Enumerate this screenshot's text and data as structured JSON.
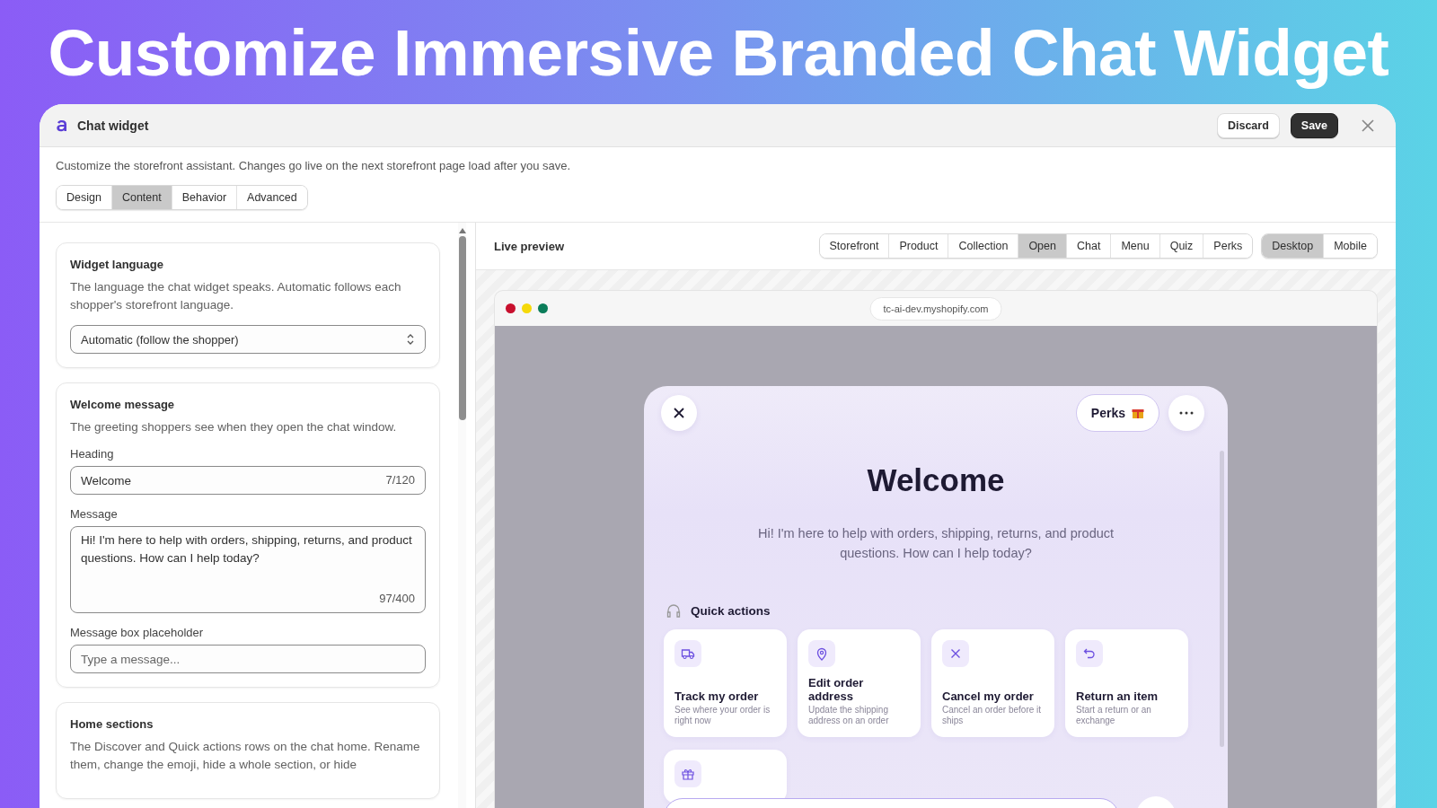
{
  "banner": {
    "headline": "Customize Immersive Branded Chat Widget"
  },
  "window": {
    "title": "Chat widget",
    "buttons": [
      {
        "label": "Discard",
        "kind": "secondary"
      },
      {
        "label": "Save",
        "kind": "primary"
      }
    ]
  },
  "description": "Customize the storefront assistant. Changes go live on the next storefront page load after you save.",
  "tabs": [
    {
      "label": "Design",
      "selected": false
    },
    {
      "label": "Content",
      "selected": true
    },
    {
      "label": "Behavior",
      "selected": false
    },
    {
      "label": "Advanced",
      "selected": false
    }
  ],
  "settings_cards": [
    {
      "title": "Widget language",
      "description": "The language the chat widget speaks. Automatic follows each shopper's storefront language.",
      "fields": [
        {
          "kind": "select",
          "value": "Automatic (follow the shopper)"
        }
      ]
    },
    {
      "title": "Welcome message",
      "description": "The greeting shoppers see when they open the chat window.",
      "fields": [
        {
          "kind": "text",
          "label": "Heading",
          "value": "Welcome",
          "counter": "7/120"
        },
        {
          "kind": "textarea",
          "label": "Message",
          "value": "Hi! I'm here to help with orders, shipping, returns, and product questions. How can I help today?",
          "counter": "97/400"
        },
        {
          "kind": "text",
          "label": "Message box placeholder",
          "placeholder": "Type a message..."
        }
      ]
    },
    {
      "title": "Home sections",
      "description": "The Discover and Quick actions rows on the chat home. Rename them, change the emoji, hide a whole section, or hide"
    }
  ],
  "preview": {
    "title": "Live preview",
    "pages": [
      {
        "label": "Storefront",
        "selected": false
      },
      {
        "label": "Product",
        "selected": false
      },
      {
        "label": "Collection",
        "selected": false
      },
      {
        "label": "Open",
        "selected": true
      },
      {
        "label": "Chat",
        "selected": false
      },
      {
        "label": "Menu",
        "selected": false
      },
      {
        "label": "Quiz",
        "selected": false
      },
      {
        "label": "Perks",
        "selected": false
      }
    ],
    "devices": [
      {
        "label": "Desktop",
        "selected": true
      },
      {
        "label": "Mobile",
        "selected": false
      }
    ],
    "browser": {
      "dots": [
        {
          "color": "#c8102e"
        },
        {
          "color": "#f5d90a"
        },
        {
          "color": "#0b7d5a"
        }
      ],
      "url": "tc-ai-dev.myshopify.com"
    },
    "widget": {
      "perks_label": "Perks",
      "heading": "Welcome",
      "message": "Hi! I'm here to help with orders, shipping, returns, and product questions. How can I help today?",
      "quick_actions_title": "Quick actions",
      "quick_actions": [
        {
          "kind": "truck",
          "title": "Track my order",
          "description": "See where your order is right now"
        },
        {
          "kind": "pin",
          "title": "Edit order address",
          "description": "Update the shipping address on an order"
        },
        {
          "kind": "cross",
          "title": "Cancel my order",
          "description": "Cancel an order before it ships"
        },
        {
          "kind": "undo",
          "title": "Return an item",
          "description": "Start a return or an exchange"
        },
        {
          "kind": "gift"
        }
      ]
    }
  }
}
